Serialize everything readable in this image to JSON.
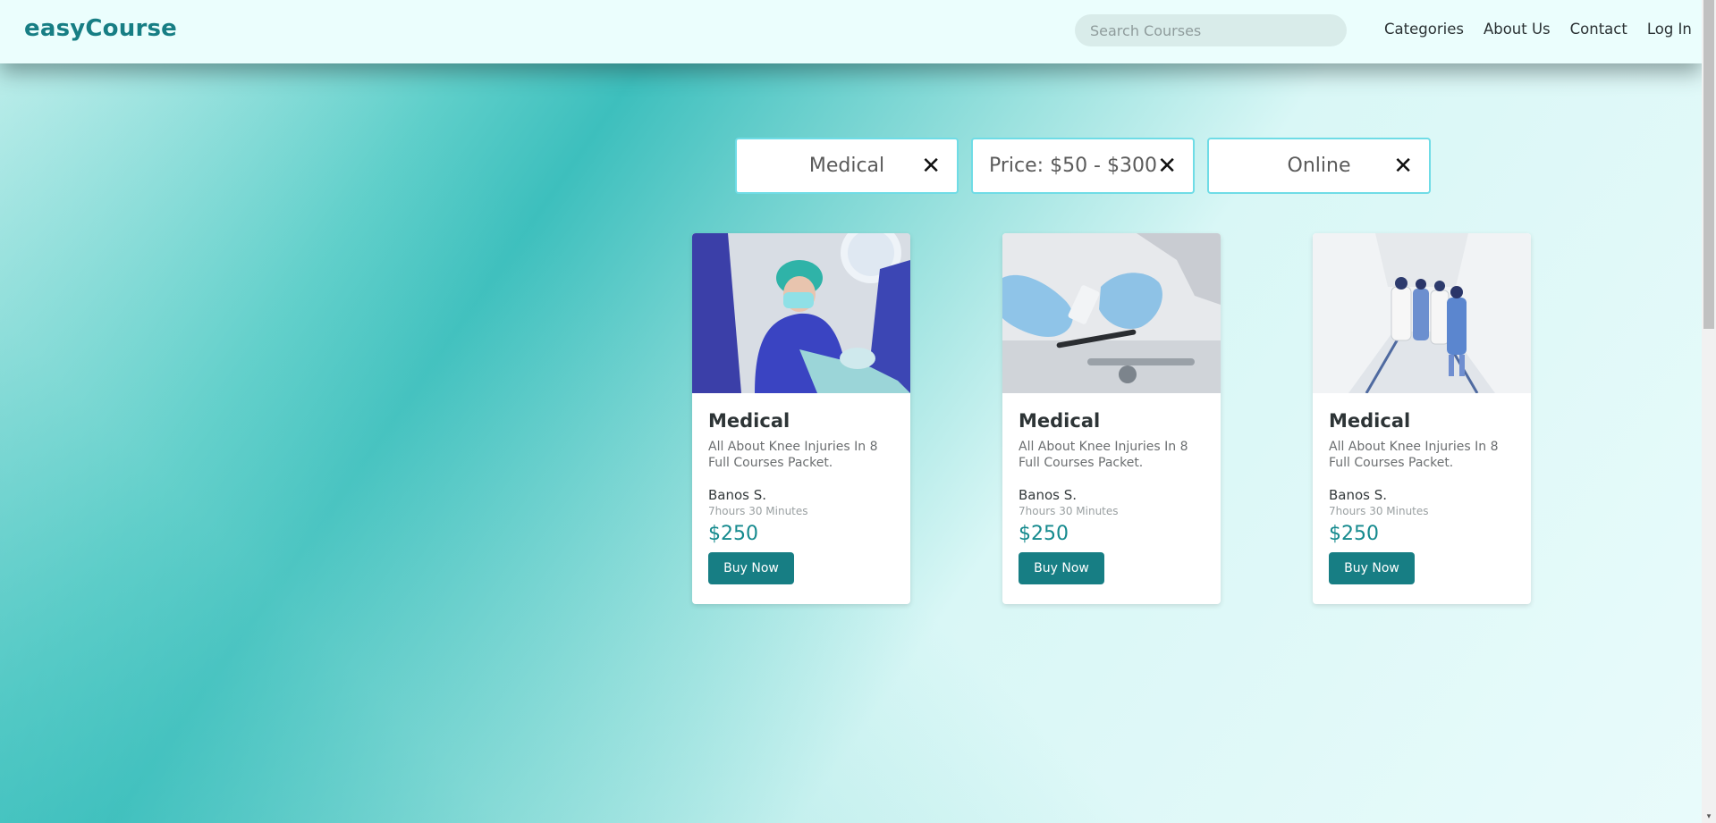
{
  "header": {
    "logo": "easyCourse",
    "search_placeholder": "Search Courses",
    "nav": [
      "Categories",
      "About Us",
      "Contact",
      "Log In"
    ]
  },
  "filters": [
    {
      "label": "Medical",
      "close": "✕"
    },
    {
      "label": "Price: $50 - $300",
      "close": "✕"
    },
    {
      "label": "Online",
      "close": "✕"
    }
  ],
  "courses": [
    {
      "title": "Medical",
      "description": "All About Knee Injuries In 8 Full Courses Packet.",
      "author": "Banos S.",
      "duration": "7hours 30 Minutes",
      "price": "$250",
      "button": "Buy Now",
      "image": "surgeon-in-operating-room"
    },
    {
      "title": "Medical",
      "description": "All About Knee Injuries In 8 Full Courses Packet.",
      "author": "Banos S.",
      "duration": "7hours 30 Minutes",
      "price": "$250",
      "button": "Buy Now",
      "image": "gloved-hands-with-vial"
    },
    {
      "title": "Medical",
      "description": "All About Knee Injuries In 8 Full Courses Packet.",
      "author": "Banos S.",
      "duration": "7hours 30 Minutes",
      "price": "$250",
      "button": "Buy Now",
      "image": "medical-staff-in-hallway"
    }
  ],
  "colors": {
    "brand": "#177e84",
    "header_bg": "#ebfefd",
    "chip_border": "#6fdce6",
    "price": "#158a8e"
  }
}
